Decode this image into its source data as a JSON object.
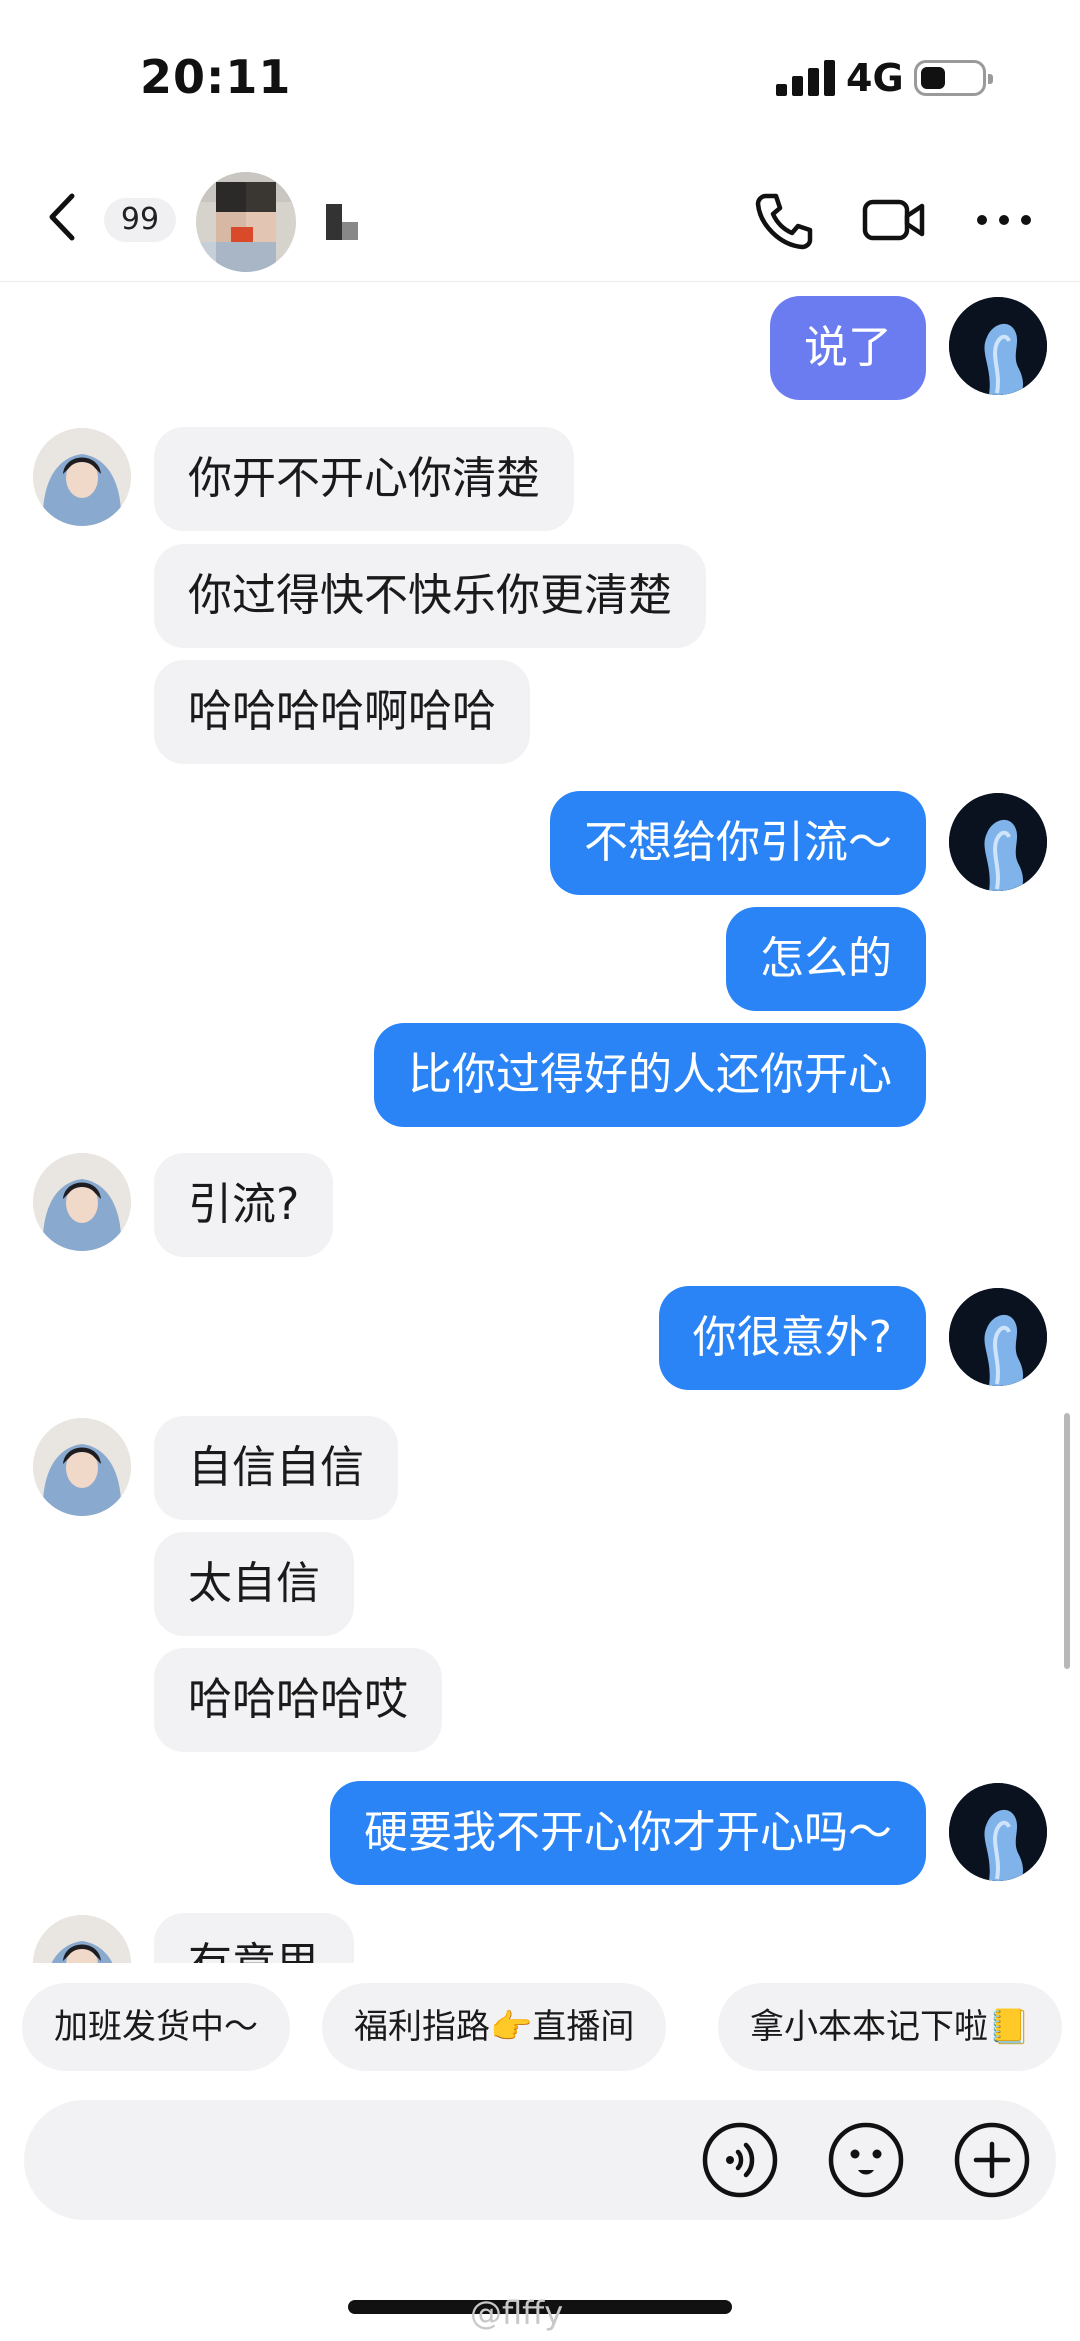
{
  "status_bar": {
    "time": "20:11",
    "network": "4G"
  },
  "nav": {
    "unread_count": "99"
  },
  "messages": [
    {
      "side": "out",
      "text": "说了"
    },
    {
      "side": "in",
      "text": "你开不开心你清楚"
    },
    {
      "side": "in",
      "text": "你过得快不快乐你更清楚"
    },
    {
      "side": "in",
      "text": "哈哈哈哈啊哈哈"
    },
    {
      "side": "out",
      "text": "不想给你引流～"
    },
    {
      "side": "out",
      "text": "怎么的"
    },
    {
      "side": "out",
      "text": "比你过得好的人还你开心"
    },
    {
      "side": "in",
      "text": "引流?"
    },
    {
      "side": "out",
      "text": "你很意外?"
    },
    {
      "side": "in",
      "text": "自信自信"
    },
    {
      "side": "in",
      "text": "太自信"
    },
    {
      "side": "in",
      "text": "哈哈哈哈哎"
    },
    {
      "side": "out",
      "text": "硬要我不开心你才开心吗～"
    },
    {
      "side": "in",
      "text": "有意思"
    }
  ],
  "quick_replies": [
    "加班发货中～",
    "福利指路👉直播间",
    "拿小本本记下啦📒"
  ],
  "input": {
    "value": "",
    "placeholder": ""
  },
  "watermark": "@flffy",
  "colors": {
    "outgoing": "#2a84f6",
    "outgoing_alt": "#6a7cf0",
    "incoming": "#f2f2f5"
  },
  "icons": [
    "back-icon",
    "phone-icon",
    "video-call-icon",
    "more-icon",
    "voice-icon",
    "emoji-icon",
    "add-icon"
  ]
}
